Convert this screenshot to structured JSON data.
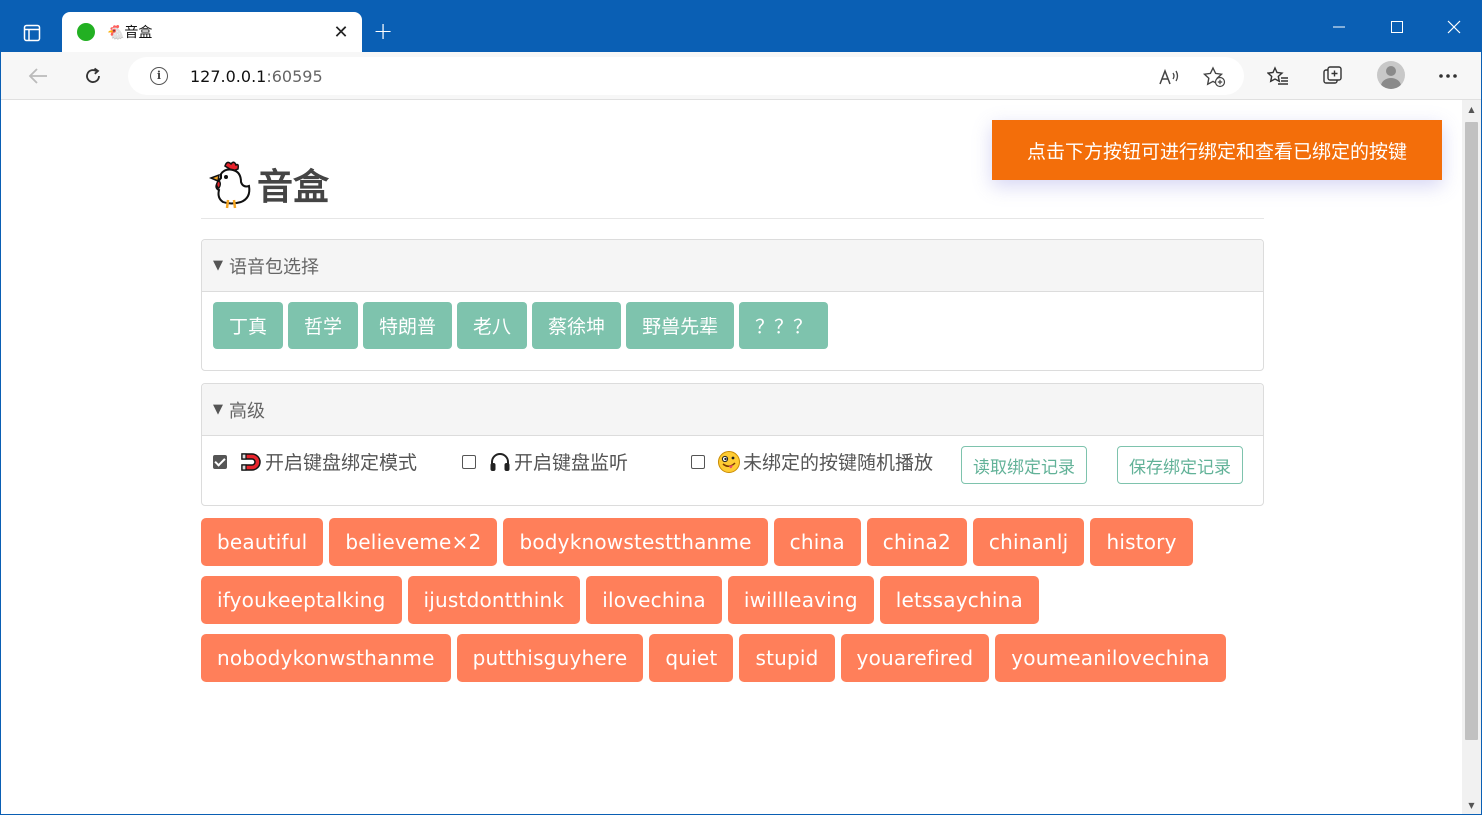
{
  "browser": {
    "tab_title": "🐔音盒",
    "url_host": "127.0.0.1",
    "url_port": ":60595"
  },
  "toast": {
    "text": "点击下方按钮可进行绑定和查看已绑定的按键"
  },
  "header": {
    "title": "音盒"
  },
  "voice_pack": {
    "title": "语音包选择",
    "packs": [
      "丁真",
      "哲学",
      "特朗普",
      "老八",
      "蔡徐坤",
      "野兽先辈",
      "？？？"
    ]
  },
  "advanced": {
    "title": "高级",
    "options": [
      {
        "label": "开启键盘绑定模式",
        "checked": true,
        "icon": "magnet-icon"
      },
      {
        "label": "开启键盘监听",
        "checked": false,
        "icon": "headphones-icon"
      },
      {
        "label": "未绑定的按键随机播放",
        "checked": false,
        "icon": "zany-face-icon"
      }
    ],
    "read_button": "读取绑定记录",
    "save_button": "保存绑定记录"
  },
  "sounds": [
    "beautiful",
    "believeme×2",
    "bodyknowstestthanme",
    "china",
    "china2",
    "chinanlj",
    "history",
    "ifyoukeeptalking",
    "ijustdontthink",
    "ilovechina",
    "iwillleaving",
    "letssaychina",
    "nobodykonwsthanme",
    "putthisguyhere",
    "quiet",
    "stupid",
    "youarefired",
    "youmeanilovechina"
  ],
  "colors": {
    "browser_frame": "#0a5fb4",
    "toast": "#f36e0a",
    "pack_button": "#7ec3ad",
    "sound_button": "#ff7f5a"
  }
}
